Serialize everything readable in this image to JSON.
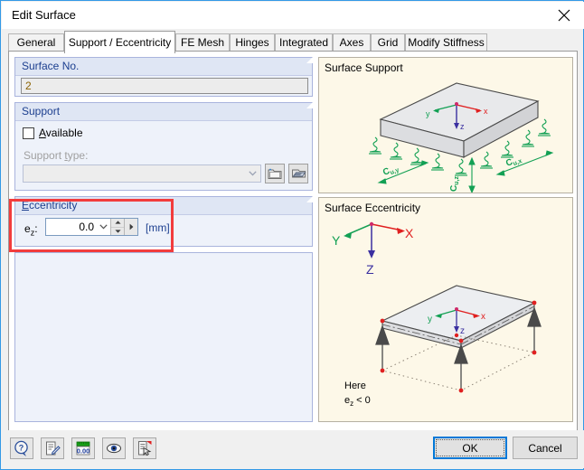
{
  "window": {
    "title": "Edit Surface",
    "close_icon": "close-icon"
  },
  "tabs": [
    {
      "label": "General",
      "active": false
    },
    {
      "label": "Support / Eccentricity",
      "active": true
    },
    {
      "label": "FE Mesh",
      "active": false
    },
    {
      "label": "Hinges",
      "active": false
    },
    {
      "label": "Integrated",
      "active": false
    },
    {
      "label": "Axes",
      "active": false
    },
    {
      "label": "Grid",
      "active": false
    },
    {
      "label": "Modify Stiffness",
      "active": false
    }
  ],
  "surface_no": {
    "group_title": "Surface No.",
    "value": "2"
  },
  "support": {
    "group_title": "Support",
    "available_label": "Available",
    "available_accel": "A",
    "available_checked": false,
    "support_type_label": "Support type:",
    "support_type_accel": "t",
    "support_type_value": "",
    "new_button_icon": "new-folder-icon",
    "edit_button_icon": "edit-library-icon"
  },
  "eccentricity": {
    "group_title": "Eccentricity",
    "group_accel": "E",
    "field_label": "e",
    "field_sub": "z",
    "field_label_suffix": ":",
    "value": "0.0",
    "unit": "[mm]",
    "dropdown_icon": "chevron-down-icon",
    "spinner_icon": "spinner-updown-icon",
    "more_icon": "arrow-right-icon",
    "highlight_color": "#f23c3c"
  },
  "pictures": {
    "support": {
      "title": "Surface Support",
      "global_axes": {
        "x": "x",
        "y": "y",
        "z": "z"
      },
      "labels": [
        "Cu,y",
        "Cu,z",
        "Cu,x"
      ]
    },
    "eccentricity": {
      "title": "Surface Eccentricity",
      "global_axes": {
        "X": "X",
        "Y": "Y",
        "Z": "Z"
      },
      "local_axes": {
        "x": "x",
        "y": "y",
        "z": "z"
      },
      "note_line1": "Here",
      "note_line2_prefix": "e",
      "note_line2_sub": "z",
      "note_line2_suffix": " < 0"
    }
  },
  "footer": {
    "tools": [
      {
        "name": "help-icon",
        "title": "Help"
      },
      {
        "name": "edit-note-icon",
        "title": "Edit"
      },
      {
        "name": "units-ruler-icon",
        "title": "Units and Decimal Places"
      },
      {
        "name": "view-eye-icon",
        "title": "View Mode"
      },
      {
        "name": "pick-object-icon",
        "title": "Select"
      }
    ],
    "ok_label": "OK",
    "cancel_label": "Cancel"
  }
}
